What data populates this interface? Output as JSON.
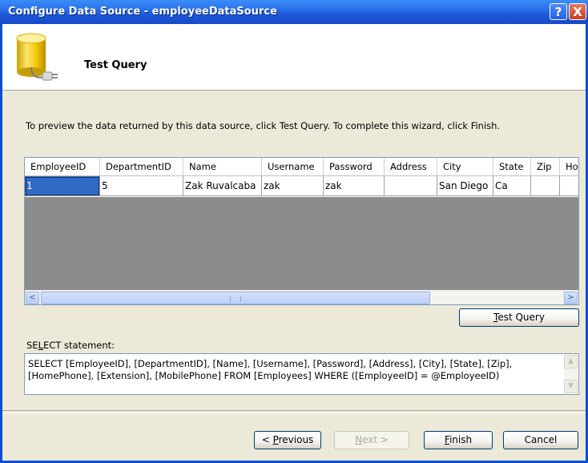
{
  "window": {
    "title": "Configure Data Source - employeeDataSource",
    "help_glyph": "?",
    "close_glyph": "X"
  },
  "header": {
    "title": "Test Query",
    "icon": "database-plug-icon"
  },
  "instructions": "To preview the data returned by this data source, click Test Query. To complete this wizard, click Finish.",
  "grid": {
    "columns": [
      "EmployeeID",
      "DepartmentID",
      "Name",
      "Username",
      "Password",
      "Address",
      "City",
      "State",
      "Zip",
      "Ho"
    ],
    "rows": [
      [
        "1",
        "5",
        "Zak Ruvalcaba",
        "zak",
        "zak",
        "",
        "San Diego",
        "Ca",
        "",
        ""
      ]
    ],
    "scroll_left": "<",
    "scroll_right": ">"
  },
  "buttons": {
    "test_query_u": "T",
    "test_query_rest": "est Query",
    "previous_pre": "< ",
    "previous_u": "P",
    "previous_rest": "revious",
    "next_u": "N",
    "next_rest": "ext >",
    "finish_u": "F",
    "finish_rest": "inish",
    "cancel": "Cancel"
  },
  "select_statement": {
    "label_pre": "SE",
    "label_u": "L",
    "label_rest": "ECT statement:",
    "sql": "SELECT [EmployeeID], [DepartmentID], [Name], [Username], [Password], [Address], [City], [State], [Zip], [HomePhone], [Extension], [MobilePhone] FROM [Employees] WHERE ([EmployeeID] = @EmployeeID)"
  }
}
